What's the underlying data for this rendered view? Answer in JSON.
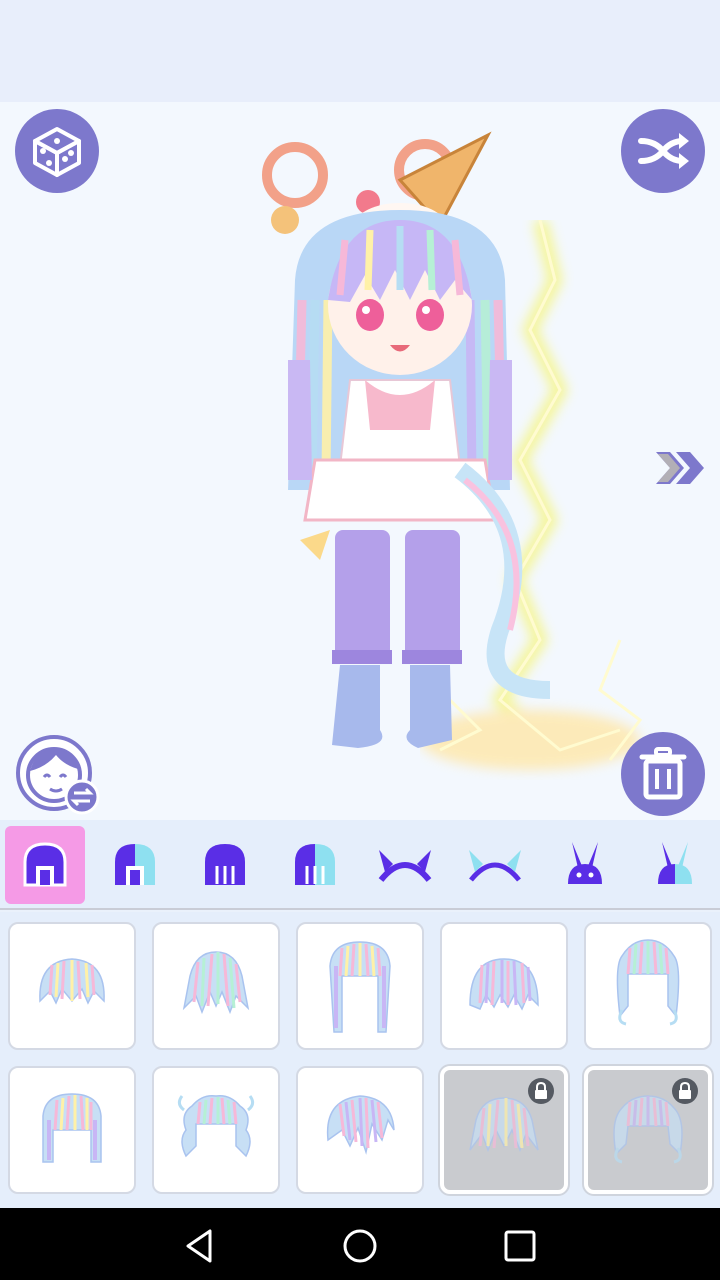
{
  "app": {
    "screen": "hair-selection"
  },
  "toolbar": {
    "randomize": {
      "icon": "dice-icon"
    },
    "shuffle": {
      "icon": "shuffle-icon"
    },
    "face_swap": {
      "icon": "face-swap-icon"
    },
    "delete": {
      "icon": "trash-icon"
    },
    "next": {
      "icon": "double-chevron-right-icon"
    }
  },
  "categories": [
    {
      "name": "front-hair",
      "icon": "hair-front-icon",
      "active": true
    },
    {
      "name": "back-hair",
      "icon": "hair-back-icon",
      "active": false
    },
    {
      "name": "long-hair",
      "icon": "hair-long-icon",
      "active": false
    },
    {
      "name": "two-tone-hair",
      "icon": "hair-two-tone-icon",
      "active": false
    },
    {
      "name": "horns",
      "icon": "horns-icon",
      "active": false
    },
    {
      "name": "horns-light",
      "icon": "horns-light-icon",
      "active": false
    },
    {
      "name": "bunny-ears",
      "icon": "bunny-ears-icon",
      "active": false
    },
    {
      "name": "bunny-ears-light",
      "icon": "bunny-ears-light-icon",
      "active": false
    }
  ],
  "hair_items": [
    {
      "style": "short-bob",
      "locked": false
    },
    {
      "style": "messy-short",
      "locked": false
    },
    {
      "style": "long-wavy",
      "locked": false
    },
    {
      "style": "straight-bangs",
      "locked": false
    },
    {
      "style": "curly-ends",
      "locked": false
    },
    {
      "style": "hime-cut",
      "locked": false
    },
    {
      "style": "curly-fluffy",
      "locked": false
    },
    {
      "style": "side-swept",
      "locked": false
    },
    {
      "style": "spiky-short",
      "locked": true
    },
    {
      "style": "wavy-medium",
      "locked": true
    }
  ],
  "colors": {
    "accent": "#7d78cc",
    "active_tab": "#f59ae6",
    "icon_purple": "#5a2ee6",
    "icon_light": "#8ee0f0"
  },
  "system_nav": [
    "back-icon",
    "home-icon",
    "recents-icon"
  ]
}
